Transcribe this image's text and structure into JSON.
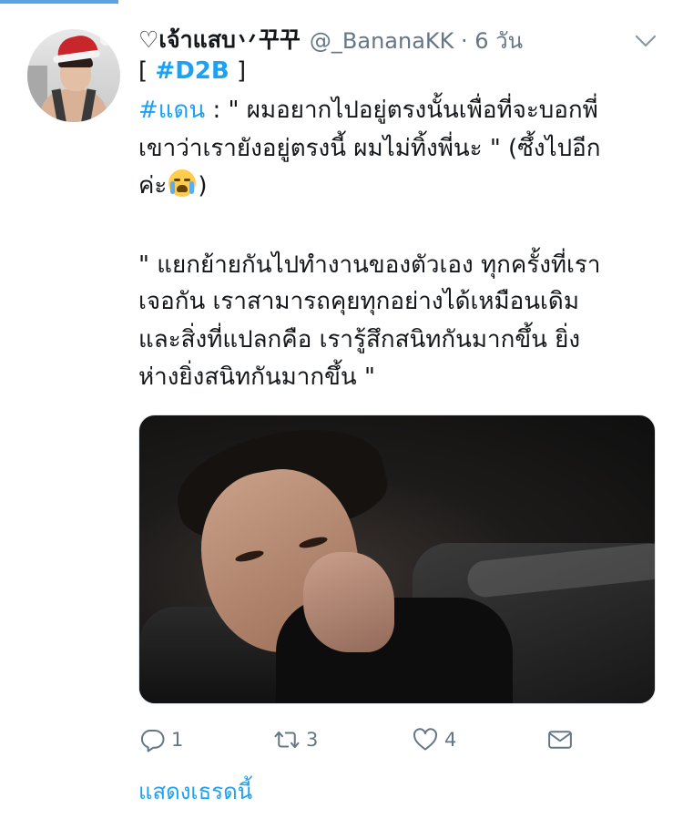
{
  "tweet": {
    "display_name": "♡เจ้าแสบ丷꾸꾸",
    "handle_time": "@_BananaKK · 6 วัน",
    "lines": {
      "l1_open": "[ ",
      "l1_tag": "#D2B",
      "l1_close": " ]",
      "l2_hashtag": "#แดน",
      "l2_rest": " : \" ผมอยากไปอยู่ตรงนั้นเพื่อที่จะบอกพี่",
      "l3": "เขาว่าเรายังอยู่ตรงนี้ ผมไม่ทิ้งพี่นะ \" (ซึ้งไปอีก",
      "l4_before": "ค่ะ",
      "l4_after": ")",
      "l6": "\" แยกย้ายกันไปทำงานของตัวเอง ทุกครั้งที่เรา",
      "l7": "เจอกัน เราสามารถคุยทุกอย่างได้เหมือนเดิม",
      "l8": "และสิ่งที่แปลกคือ เรารู้สึกสนิทกันมากขึ้น ยิ่ง",
      "l9": "ห่างยิ่งสนิทกันมากขึ้น \""
    },
    "emoji": "loudly-crying-face",
    "actions": {
      "reply_count": "1",
      "retweet_count": "3",
      "like_count": "4"
    },
    "show_thread": "แสดงเธรดนี้"
  },
  "colors": {
    "link": "#1da1f2",
    "muted": "#657786",
    "text": "#14171a",
    "top_progress": "#5ba4e0"
  },
  "icons": {
    "more": "chevron-down-icon",
    "reply": "reply-icon",
    "retweet": "retweet-icon",
    "like": "heart-icon",
    "dm": "envelope-icon"
  }
}
